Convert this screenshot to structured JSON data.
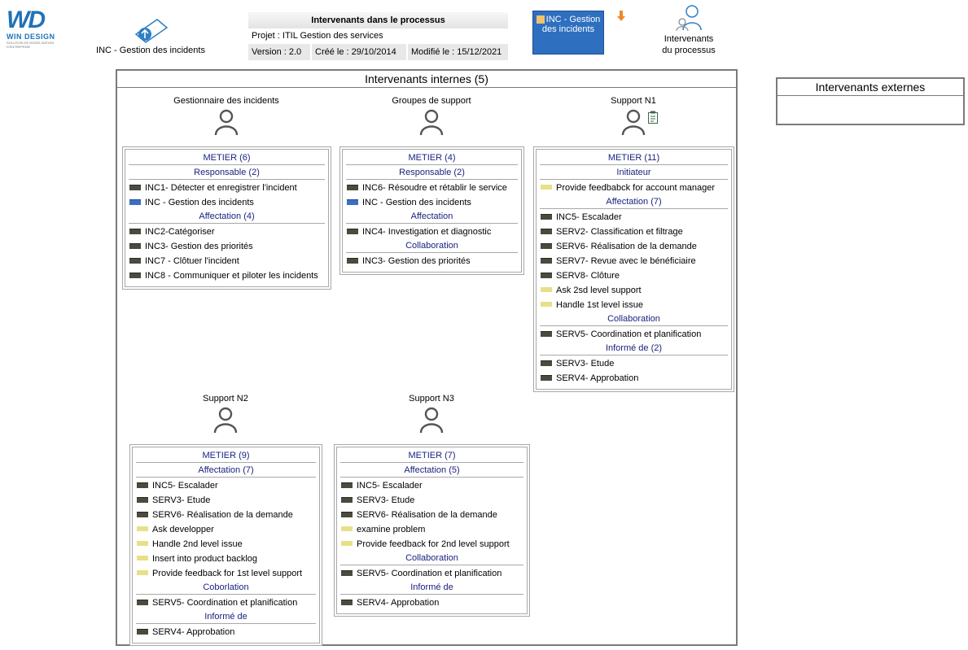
{
  "logo": {
    "mark": "WD",
    "name": "WIN DESIGN",
    "tagline": "SOLUTION DE MODELISATION D'ENTREPRISE"
  },
  "nav": {
    "process_label": "INC - Gestion des incidents",
    "actors_line1": "Intervenants",
    "actors_line2": "du processus"
  },
  "info": {
    "title": "Intervenants dans le processus",
    "project": "Projet : ITIL Gestion des services",
    "version": "Version : 2.0",
    "created": "Créé le : 29/10/2014",
    "modified": "Modifié le : 15/12/2021"
  },
  "inc_button": {
    "line1": "INC - Gestion",
    "line2": "des incidents"
  },
  "internal": {
    "title": "Intervenants internes (5)"
  },
  "external": {
    "title": "Intervenants externes"
  },
  "colors": {
    "dark_chip": "#4a4a3f",
    "blue_chip": "#3c6fc4",
    "yellow_chip": "#e7e089",
    "section_text": "#1a237e"
  },
  "actors": [
    {
      "name": "Gestionnaire des incidents",
      "metier": "METIER (6)",
      "sections": [
        {
          "title": "Responsable (2)",
          "items": [
            {
              "label": "INC1- Détecter et enregistrer l'incident",
              "chip": "dark"
            },
            {
              "label": "INC - Gestion des incidents",
              "chip": "blue"
            }
          ]
        },
        {
          "title": "Affectation (4)",
          "items": [
            {
              "label": "INC2-Catégoriser",
              "chip": "dark"
            },
            {
              "label": "INC3- Gestion des priorités",
              "chip": "dark"
            },
            {
              "label": "INC7 - Clôtuer l'incident",
              "chip": "dark"
            },
            {
              "label": "INC8 - Communiquer et piloter les incidents",
              "chip": "dark"
            }
          ]
        }
      ]
    },
    {
      "name": "Groupes de support",
      "metier": "METIER (4)",
      "sections": [
        {
          "title": "Responsable (2)",
          "items": [
            {
              "label": "INC6- Résoudre et rétablir le service",
              "chip": "dark"
            },
            {
              "label": "INC - Gestion des incidents",
              "chip": "blue"
            }
          ]
        },
        {
          "title": "Affectation",
          "items": [
            {
              "label": "INC4- Investigation et diagnostic",
              "chip": "dark"
            }
          ]
        },
        {
          "title": "Collaboration",
          "items": [
            {
              "label": "INC3- Gestion des priorités",
              "chip": "dark"
            }
          ]
        }
      ]
    },
    {
      "name": "Support N1",
      "metier": "METIER (11)",
      "sections": [
        {
          "title": "Initiateur",
          "items": [
            {
              "label": "Provide feedbabck for account manager",
              "chip": "yellow"
            }
          ]
        },
        {
          "title": "Affectation (7)",
          "items": [
            {
              "label": "INC5- Escalader",
              "chip": "dark"
            },
            {
              "label": "SERV2- Classification et filtrage",
              "chip": "dark"
            },
            {
              "label": "SERV6- Réalisation de la demande",
              "chip": "dark"
            },
            {
              "label": "SERV7- Revue avec le bénéficiaire",
              "chip": "dark"
            },
            {
              "label": "SERV8- Clôture",
              "chip": "dark"
            },
            {
              "label": "Ask 2sd level support",
              "chip": "yellow"
            },
            {
              "label": "Handle 1st level issue",
              "chip": "yellow"
            }
          ]
        },
        {
          "title": "Collaboration",
          "items": [
            {
              "label": "SERV5- Coordination et planification",
              "chip": "dark"
            }
          ]
        },
        {
          "title": "Informé de (2)",
          "items": [
            {
              "label": "SERV3- Etude",
              "chip": "dark"
            },
            {
              "label": "SERV4- Approbation",
              "chip": "dark"
            }
          ]
        }
      ]
    },
    {
      "name": "Support N2",
      "metier": "METIER (9)",
      "sections": [
        {
          "title": "Affectation (7)",
          "items": [
            {
              "label": "INC5- Escalader",
              "chip": "dark"
            },
            {
              "label": "SERV3- Etude",
              "chip": "dark"
            },
            {
              "label": "SERV6- Réalisation de la demande",
              "chip": "dark"
            },
            {
              "label": "Ask developper",
              "chip": "yellow"
            },
            {
              "label": "Handle 2nd level issue",
              "chip": "yellow"
            },
            {
              "label": "Insert into product backlog",
              "chip": "yellow"
            },
            {
              "label": "Provide feedback for 1st level support",
              "chip": "yellow"
            }
          ]
        },
        {
          "title": "Coborlation",
          "items": [
            {
              "label": "SERV5- Coordination et planification",
              "chip": "dark"
            }
          ]
        },
        {
          "title": "Informé de",
          "items": [
            {
              "label": "SERV4- Approbation",
              "chip": "dark"
            }
          ]
        }
      ]
    },
    {
      "name": "Support N3",
      "metier": "METIER (7)",
      "sections": [
        {
          "title": "Affectation (5)",
          "items": [
            {
              "label": "INC5- Escalader",
              "chip": "dark"
            },
            {
              "label": "SERV3- Etude",
              "chip": "dark"
            },
            {
              "label": "SERV6- Réalisation de la demande",
              "chip": "dark"
            },
            {
              "label": "examine problem",
              "chip": "yellow"
            },
            {
              "label": "Provide feedback for 2nd level support",
              "chip": "yellow"
            }
          ]
        },
        {
          "title": "Collaboration",
          "items": [
            {
              "label": "SERV5- Coordination et planification",
              "chip": "dark"
            }
          ]
        },
        {
          "title": "Informé de",
          "items": [
            {
              "label": "SERV4- Approbation",
              "chip": "dark"
            }
          ]
        }
      ]
    }
  ]
}
